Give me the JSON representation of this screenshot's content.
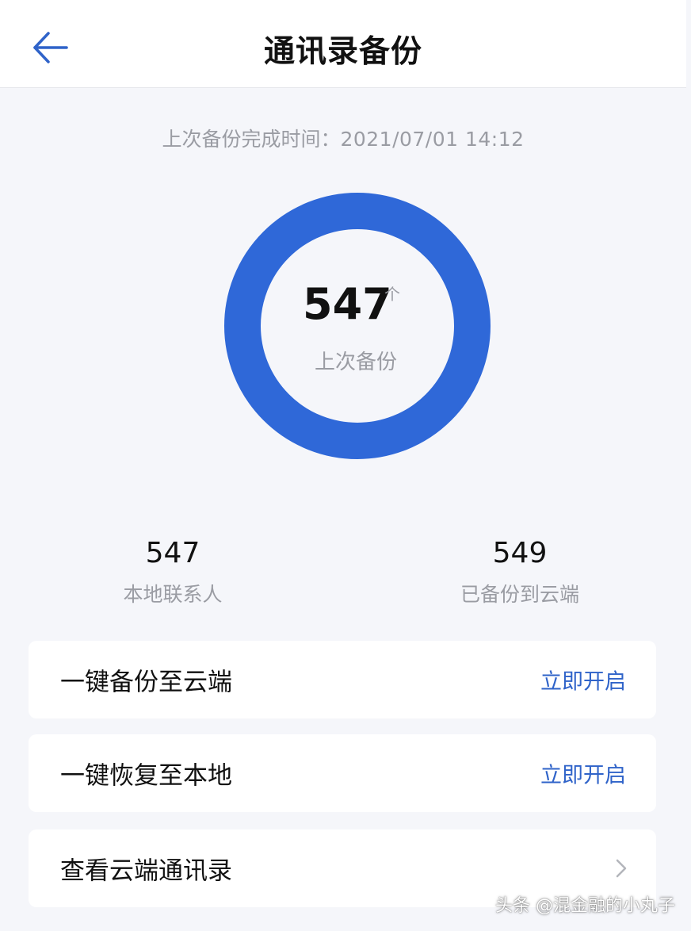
{
  "header": {
    "title": "通讯录备份",
    "back_icon": "arrow-left-icon"
  },
  "backup_info": {
    "label": "上次备份完成时间：",
    "time": "2021/07/01 14:12"
  },
  "ring": {
    "count": "547",
    "unit": "个",
    "label": "上次备份",
    "color": "#2f68d8"
  },
  "stats": {
    "local": {
      "value": "547",
      "label": "本地联系人"
    },
    "cloud": {
      "value": "549",
      "label": "已备份到云端"
    }
  },
  "actions": [
    {
      "label": "一键备份至云端",
      "action": "立即开启"
    },
    {
      "label": "一键恢复至本地",
      "action": "立即开启"
    },
    {
      "label": "查看云端通讯录",
      "icon": "chevron-right-icon"
    }
  ],
  "watermark": "头条 @混金融的小丸子",
  "colors": {
    "accent": "#2f63c9",
    "background": "#f5f6fa"
  }
}
